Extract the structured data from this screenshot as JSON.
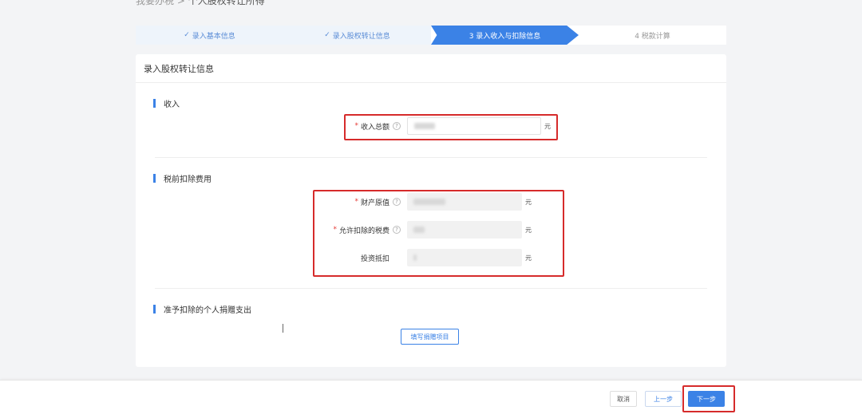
{
  "breadcrumb": {
    "parent": "我要办税",
    "separator": ">",
    "current": "个人股权转让所得"
  },
  "steps": [
    {
      "label": "录入基本信息",
      "state": "done"
    },
    {
      "label": "录入股权转让信息",
      "state": "done"
    },
    {
      "label": "3  录入收入与扣除信息",
      "state": "active"
    },
    {
      "label": "4  税款计算",
      "state": "todo"
    }
  ],
  "card_title": "录入股权转让信息",
  "sections": {
    "income": "收入",
    "deduction": "税前扣除费用",
    "donation": "准予扣除的个人捐赠支出"
  },
  "fields": {
    "income_total": {
      "label": "收入总额",
      "required": true,
      "unit": "元"
    },
    "original_value": {
      "label": "财产原值",
      "required": true,
      "unit": "元"
    },
    "allowed_tax": {
      "label": "允许扣除的税费",
      "required": true,
      "unit": "元"
    },
    "investment_offset": {
      "label": "投资抵扣",
      "required": false,
      "unit": "元"
    }
  },
  "help_icon": "?",
  "required_mark": "*",
  "check_glyph": "✓",
  "donation_button": "填写捐赠项目",
  "footer": {
    "cancel": "取消",
    "prev": "上一步",
    "next": "下一步"
  },
  "colors": {
    "accent": "#3b82e6",
    "highlight": "#d62b2b"
  }
}
